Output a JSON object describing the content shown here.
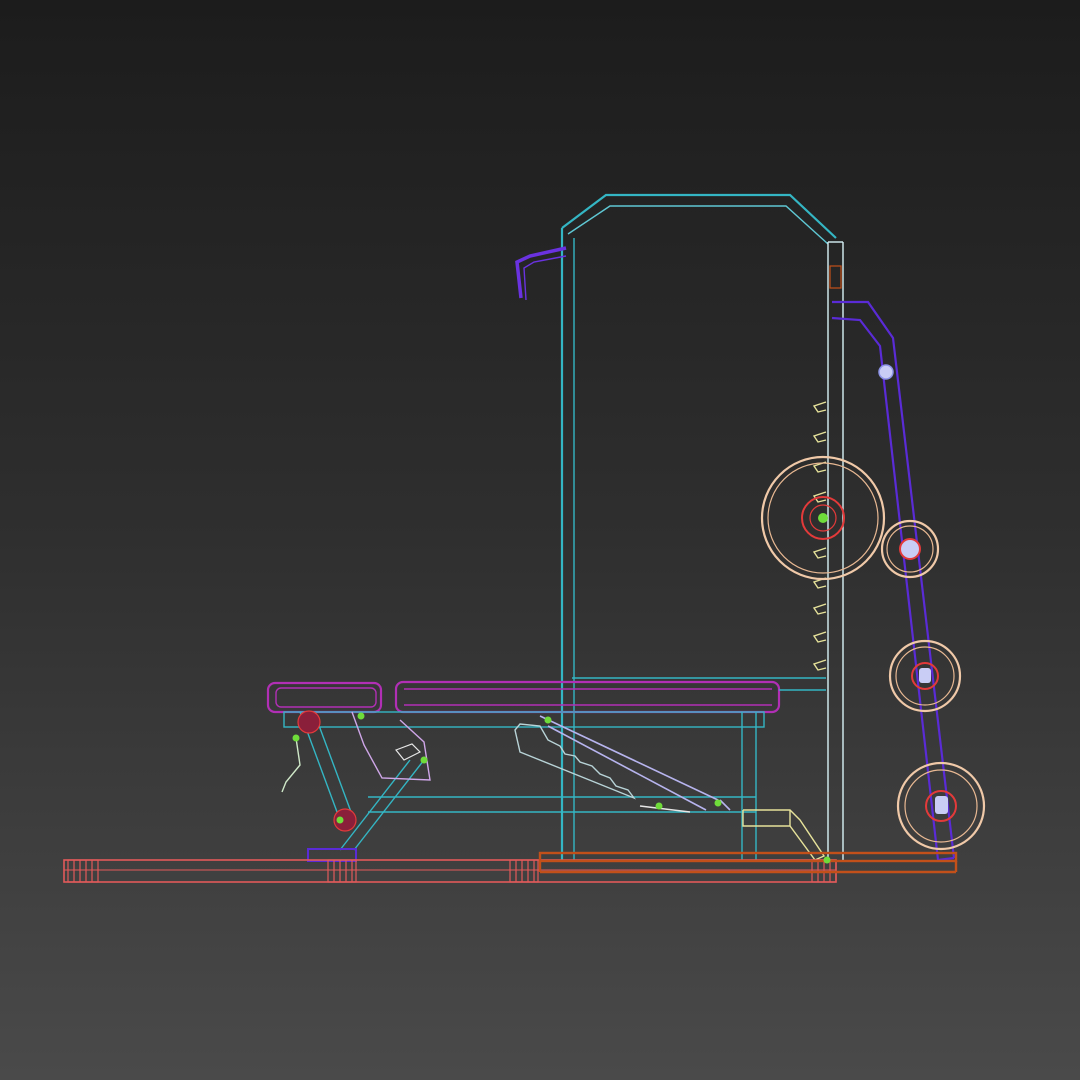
{
  "viewport": {
    "view": "wireframe",
    "colors": {
      "frame_cyan": "#34b6c4",
      "frame_cyan_light": "#8fdde6",
      "bench_pad_magenta": "#b12fb5",
      "bar_purple": "#5a2bd6",
      "plate_tan": "#f0c9a8",
      "hub_red": "#e33a3a",
      "floor_red": "#e25a5a",
      "floor_orange": "#c2501a",
      "pin_green": "#6fdc3a",
      "incline_lilac": "#b7b4ee",
      "hook_yellow": "#e6e29a",
      "lever_lilac": "#cfa6e8"
    }
  },
  "model": {
    "name": "",
    "components": [
      "rack-frame",
      "pull-up-handle",
      "weight-plate-horn",
      "bench-seat-pad",
      "bench-back-pad",
      "incline-ladder",
      "bench-leg-rear",
      "floor-base",
      "plate-storage-arm",
      "weight-plates",
      "j-hooks"
    ]
  }
}
